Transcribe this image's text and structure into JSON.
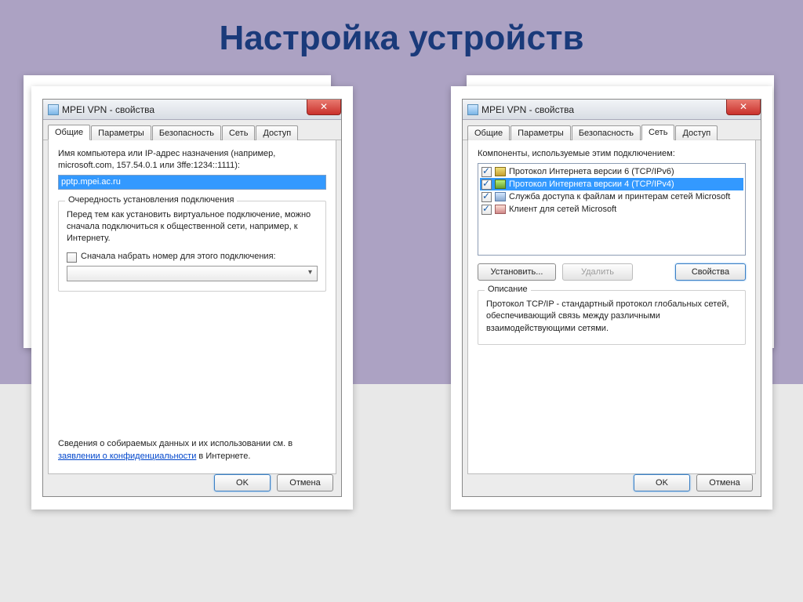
{
  "page_title": "Настройка устройств",
  "dialog_title": "MPEI VPN - свойства",
  "close_glyph": "✕",
  "tabs": {
    "general": "Общие",
    "options": "Параметры",
    "security": "Безопасность",
    "network": "Сеть",
    "sharing": "Доступ"
  },
  "left": {
    "field_label": "Имя компьютера или IP-адрес назначения (например, microsoft.com, 157.54.0.1 или 3ffe:1234::1111):",
    "field_value": "pptp.mpei.ac.ru",
    "group_legend": "Очередность установления подключения",
    "group_text": "Перед тем как установить виртуальное подключение, можно сначала подключиться к общественной сети, например, к Интернету.",
    "dial_first": "Сначала набрать номер для этого подключения:",
    "privacy_pre": "Сведения о собираемых данных и их использовании см. в ",
    "privacy_link": "заявлении о конфиденциальности",
    "privacy_post": " в Интернете."
  },
  "right": {
    "list_label": "Компоненты, используемые этим подключением:",
    "items": [
      "Протокол Интернета версии 6 (TCP/IPv6)",
      "Протокол Интернета версии 4 (TCP/IPv4)",
      "Служба доступа к файлам и принтерам сетей Microsoft",
      "Клиент для сетей Microsoft"
    ],
    "install": "Установить...",
    "remove": "Удалить",
    "properties": "Свойства",
    "desc_legend": "Описание",
    "desc_text": "Протокол TCP/IP - стандартный протокол глобальных сетей, обеспечивающий связь между различными взаимодействующими сетями."
  },
  "buttons": {
    "ok": "OK",
    "cancel": "Отмена"
  }
}
